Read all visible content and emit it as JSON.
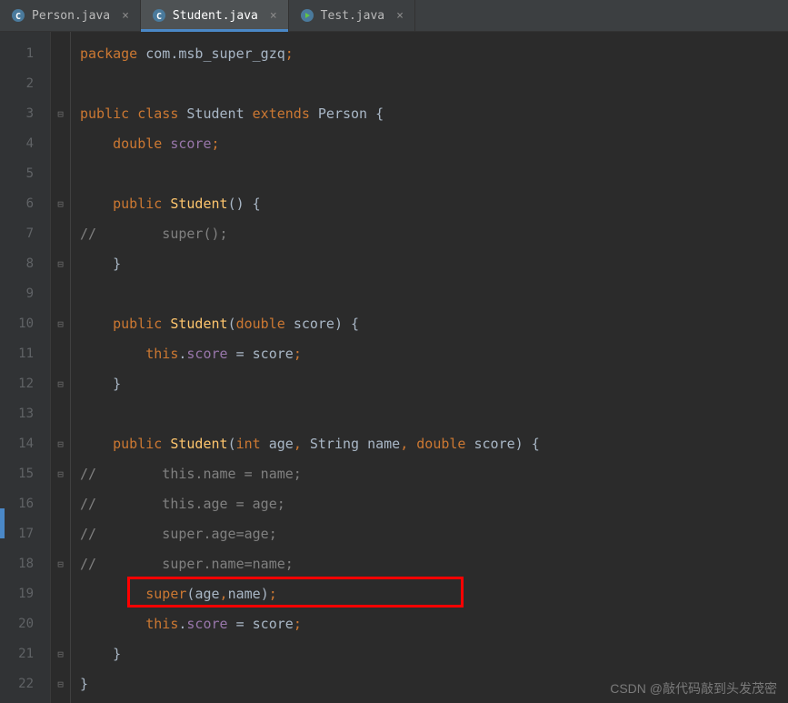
{
  "tabs": [
    {
      "label": "Person.java",
      "icon": "class",
      "active": false
    },
    {
      "label": "Student.java",
      "icon": "class",
      "active": true
    },
    {
      "label": "Test.java",
      "icon": "run",
      "active": false
    }
  ],
  "gutter": [
    "1",
    "2",
    "3",
    "4",
    "5",
    "6",
    "7",
    "8",
    "9",
    "10",
    "11",
    "12",
    "13",
    "14",
    "15",
    "16",
    "17",
    "18",
    "19",
    "20",
    "21",
    "22"
  ],
  "code": {
    "l1_package": "package ",
    "l1_pkg": "com.msb_super_gzq",
    "l1_semi": ";",
    "l3_public": "public ",
    "l3_class": "class ",
    "l3_name": "Student ",
    "l3_extends": "extends ",
    "l3_parent": "Person ",
    "l3_brace": "{",
    "l4_type": "double ",
    "l4_field": "score",
    "l4_semi": ";",
    "l6_public": "public ",
    "l6_name": "Student",
    "l6_parens": "() {",
    "l7_comment": "//        super();",
    "l8_brace": "}",
    "l10_public": "public ",
    "l10_name": "Student",
    "l10_open": "(",
    "l10_type": "double ",
    "l10_param": "score",
    "l10_close": ") {",
    "l11_this": "this",
    "l11_dot": ".",
    "l11_field": "score",
    "l11_eq": " = ",
    "l11_val": "score",
    "l11_semi": ";",
    "l12_brace": "}",
    "l14_public": "public ",
    "l14_name": "Student",
    "l14_open": "(",
    "l14_t1": "int ",
    "l14_p1": "age",
    "l14_c1": ", ",
    "l14_t2": "String ",
    "l14_p2": "name",
    "l14_c2": ", ",
    "l14_t3": "double ",
    "l14_p3": "score",
    "l14_close": ") {",
    "l15_comment": "//        this.name = name;",
    "l16_comment": "//        this.age = age;",
    "l17_comment": "//        super.age=age;",
    "l18_comment": "//        super.name=name;",
    "l19_super": "super",
    "l19_open": "(",
    "l19_a1": "age",
    "l19_c": ",",
    "l19_a2": "name",
    "l19_close": ")",
    "l19_semi": ";",
    "l20_this": "this",
    "l20_dot": ".",
    "l20_field": "score",
    "l20_eq": " = ",
    "l20_val": "score",
    "l20_semi": ";",
    "l21_brace": "}",
    "l22_brace": "}"
  },
  "watermark": "CSDN @敲代码敲到头发茂密"
}
